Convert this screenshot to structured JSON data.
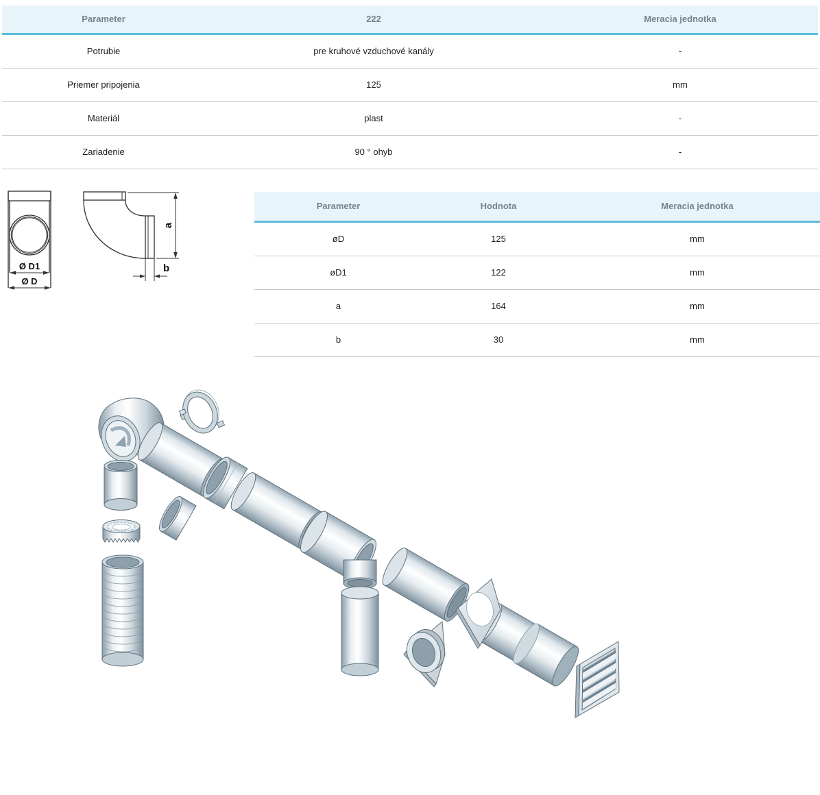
{
  "spec_table": {
    "headers": [
      "Parameter",
      "222",
      "Meracia jednotka"
    ],
    "rows": [
      [
        "Potrubie",
        "pre kruhové vzduchové kanály",
        "-"
      ],
      [
        "Priemer pripojenia",
        "125",
        "mm"
      ],
      [
        "Materiál",
        "plast",
        "-"
      ],
      [
        "Zariadenie",
        "90 ° ohyb",
        "-"
      ]
    ]
  },
  "dimension_table": {
    "headers": [
      "Parameter",
      "Hodnota",
      "Meracia jednotka"
    ],
    "rows": [
      [
        "øD",
        "125",
        "mm"
      ],
      [
        "øD1",
        "122",
        "mm"
      ],
      [
        "a",
        "164",
        "mm"
      ],
      [
        "b",
        "30",
        "mm"
      ]
    ]
  },
  "drawing_labels": {
    "front_inner_diameter": "Ø D1",
    "front_outer_diameter": "Ø D",
    "side_height": "a",
    "side_width": "b"
  },
  "colors": {
    "header_bg": "#e7f5fb",
    "accent_border": "#5bbcd9",
    "header_text": "#75828d",
    "row_separator": "#c8c8c8",
    "body_text": "#1c1c1c",
    "illustration_outline": "#5d6f7b"
  }
}
